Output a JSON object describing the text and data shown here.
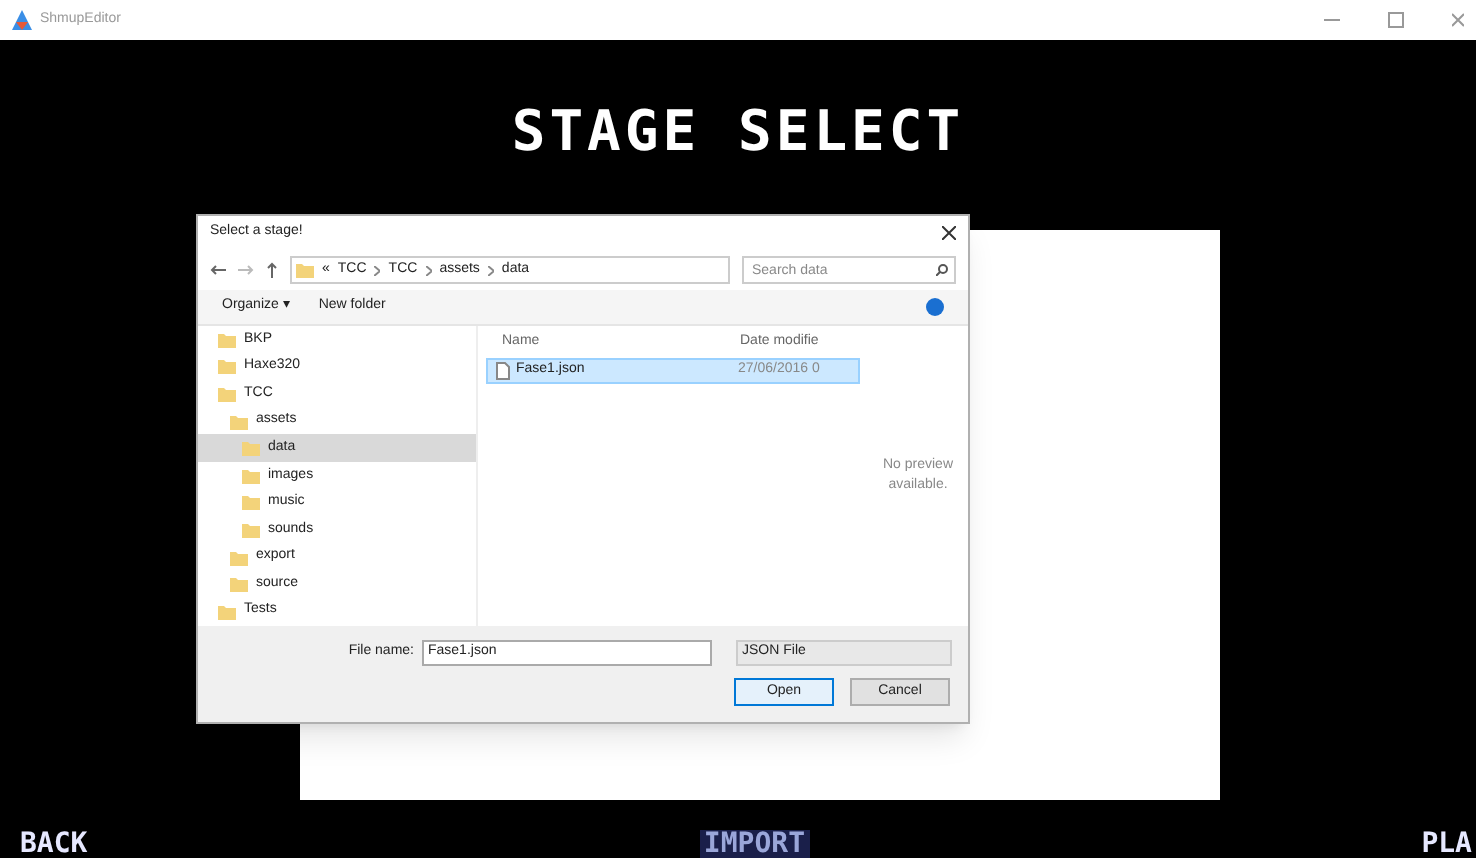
{
  "window": {
    "title": "ShmupEditor"
  },
  "heading": "STAGE SELECT",
  "dialog": {
    "title": "Select a stage!",
    "breadcrumb": [
      "«",
      "TCC",
      "TCC",
      "assets",
      "data"
    ],
    "search": {
      "placeholder": "Search data"
    },
    "toolbar": {
      "organize": "Organize ▾",
      "new_folder": "New folder"
    },
    "tree": [
      {
        "label": "BKP",
        "selected": false
      },
      {
        "label": "Haxe320",
        "selected": false
      },
      {
        "label": "TCC",
        "selected": false,
        "children": [
          {
            "label": "assets",
            "selected": false,
            "children": [
              {
                "label": "data",
                "selected": true
              },
              {
                "label": "images",
                "selected": false
              },
              {
                "label": "music",
                "selected": false
              },
              {
                "label": "sounds",
                "selected": false
              }
            ]
          },
          {
            "label": "export",
            "selected": false
          },
          {
            "label": "source",
            "selected": false
          }
        ]
      },
      {
        "label": "Tests",
        "selected": false
      }
    ],
    "columns": [
      "Name",
      "Date modifie"
    ],
    "files": [
      {
        "name": "Fase1.json",
        "date": "27/06/2016 0",
        "selected": true
      }
    ],
    "preview": "No preview available.",
    "file_name_label": "File name:",
    "file_name": "Fase1.json",
    "file_type": "JSON File",
    "open": "Open",
    "cancel": "Cancel"
  },
  "menu": [
    {
      "label": "BACK",
      "selected": false
    },
    {
      "label": "IMPORT",
      "selected": true
    },
    {
      "label": "PLA",
      "selected": false
    }
  ]
}
